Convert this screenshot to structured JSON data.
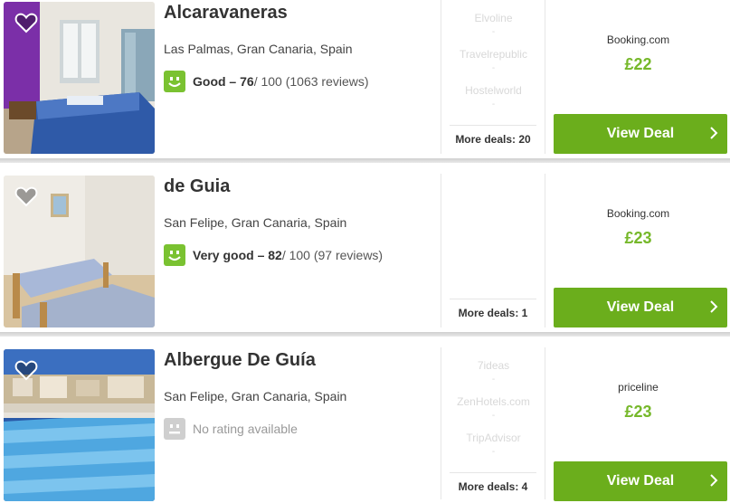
{
  "listings": [
    {
      "name": "Alcaravaneras",
      "location": "Las Palmas, Gran Canaria, Spain",
      "rating_word": "Good – 76",
      "rating_rest": " / 100 (1063 reviews)",
      "rating_none": "",
      "partners": [
        "Elvoline",
        "Travelrepublic",
        "Hostelworld"
      ],
      "more_deals": "More deals: 20",
      "provider": "Booking.com",
      "price": "£22",
      "deal_label": "View Deal"
    },
    {
      "name": "de Guia",
      "location": "San Felipe, Gran Canaria, Spain",
      "rating_word": "Very good – 82",
      "rating_rest": " / 100 (97 reviews)",
      "rating_none": "",
      "partners": [],
      "more_deals": "More deals: 1",
      "provider": "Booking.com",
      "price": "£23",
      "deal_label": "View Deal"
    },
    {
      "name": "Albergue De Guía",
      "location": "San Felipe, Gran Canaria, Spain",
      "rating_word": "",
      "rating_rest": "",
      "rating_none": "No rating available",
      "partners": [
        "7ideas",
        "ZenHotels.com",
        "TripAdvisor"
      ],
      "more_deals": "More deals: 4",
      "provider": "priceline",
      "price": "£23",
      "deal_label": "View Deal"
    }
  ],
  "colors": {
    "deal_button": "#6bae1c",
    "price": "#76b82a",
    "rating_good": "#7ac231",
    "rating_none": "#cfcfcf"
  },
  "icons": {
    "favorite": "heart-icon",
    "rating": "smiley-icon",
    "deal": "chevron-right-icon"
  }
}
